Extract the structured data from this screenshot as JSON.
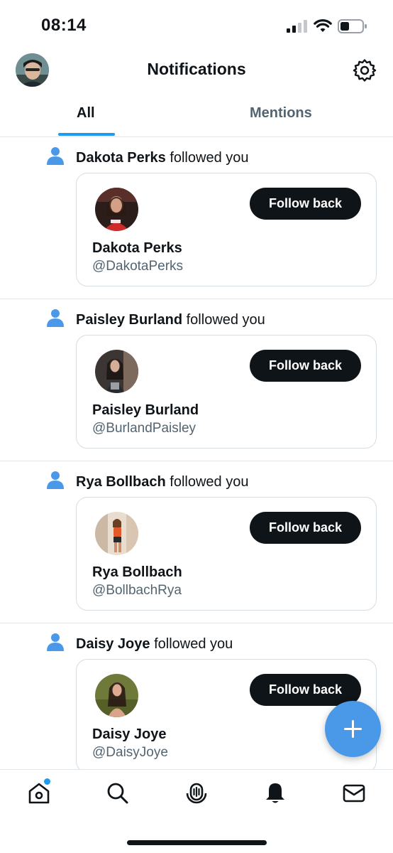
{
  "status_bar": {
    "time": "08:14"
  },
  "header": {
    "title": "Notifications"
  },
  "tabs": [
    {
      "label": "All",
      "active": true
    },
    {
      "label": "Mentions",
      "active": false
    }
  ],
  "colors": {
    "accent": "#1d9bf0",
    "fab": "#4a99e9",
    "button": "#0f1419",
    "secondary_text": "#536471"
  },
  "notifications": [
    {
      "name": "Dakota Perks",
      "action": "followed you",
      "handle": "@DakotaPerks",
      "button": "Follow back"
    },
    {
      "name": "Paisley Burland",
      "action": "followed you",
      "handle": "@BurlandPaisley",
      "button": "Follow back"
    },
    {
      "name": "Rya Bollbach",
      "action": "followed you",
      "handle": "@BollbachRya",
      "button": "Follow back"
    },
    {
      "name": "Daisy Joye",
      "action": "followed you",
      "handle": "@DaisyJoye",
      "button": "Follow back"
    }
  ],
  "icons": {
    "header": [
      "avatar",
      "gear-icon"
    ],
    "nav": [
      "home-icon",
      "search-icon",
      "spaces-icon",
      "bell-icon",
      "mail-icon"
    ],
    "fab": "plus-icon"
  }
}
